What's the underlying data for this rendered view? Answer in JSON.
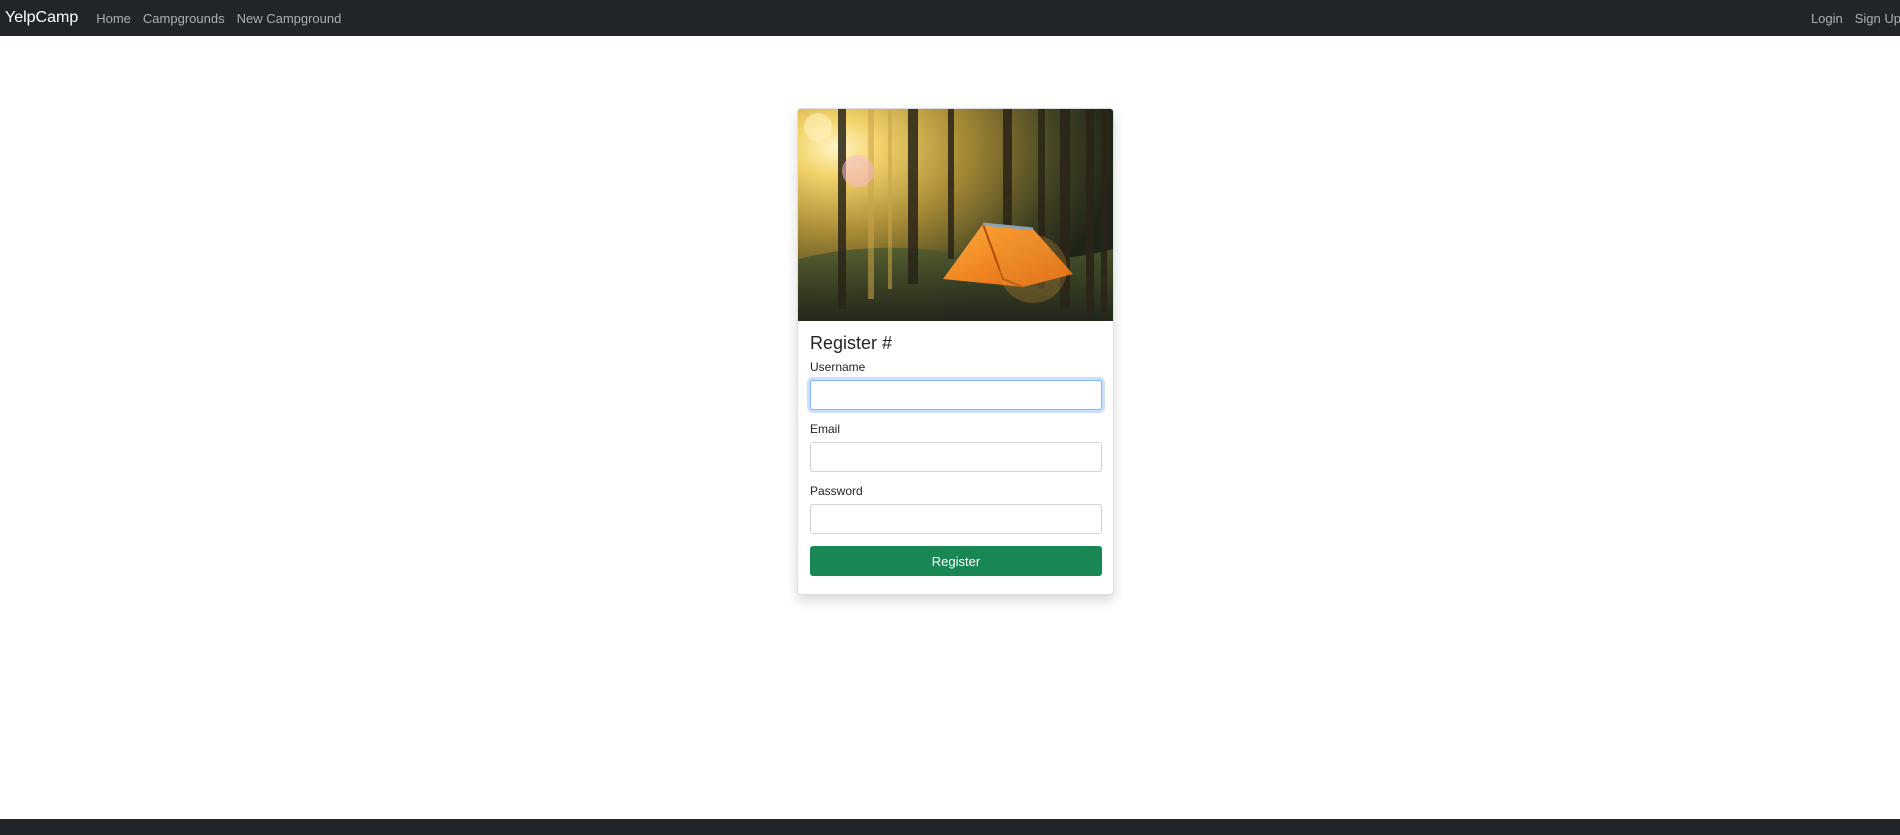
{
  "nav": {
    "brand": "YelpCamp",
    "links": [
      "Home",
      "Campgrounds",
      "New Campground"
    ],
    "login": "Login",
    "signup": "Sign Up"
  },
  "card": {
    "title": "Register #",
    "fields": {
      "username": {
        "label": "Username",
        "value": ""
      },
      "email": {
        "label": "Email",
        "value": ""
      },
      "password": {
        "label": "Password",
        "value": ""
      }
    },
    "submit_label": "Register"
  },
  "colors": {
    "navbar": "#212529",
    "button": "#198754",
    "focus": "#86b7fe"
  }
}
